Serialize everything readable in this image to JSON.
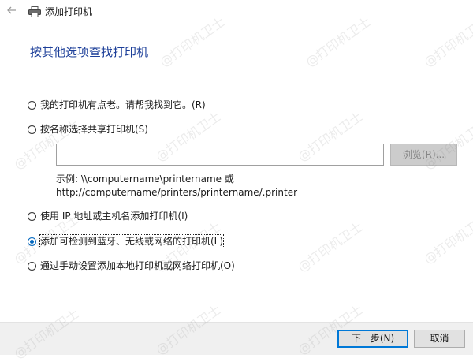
{
  "window": {
    "title": "添加打印机",
    "back_icon": "back-arrow-icon",
    "printer_icon": "printer-icon"
  },
  "heading": "按其他选项查找打印机",
  "options": [
    {
      "label": "我的打印机有点老。请帮我找到它。(R)",
      "checked": false
    },
    {
      "label": "按名称选择共享打印机(S)",
      "checked": false
    },
    {
      "label": "使用 IP 地址或主机名添加打印机(I)",
      "checked": false
    },
    {
      "label": "添加可检测到蓝牙、无线或网络的打印机(L)",
      "checked": true
    },
    {
      "label": "通过手动设置添加本地打印机或网络打印机(O)",
      "checked": false
    }
  ],
  "shared_printer": {
    "input_value": "",
    "browse_label": "浏览(R)...",
    "example_line1": "示例: \\\\computername\\printername 或",
    "example_line2": "http://computername/printers/printername/.printer"
  },
  "footer": {
    "next_label": "下一步(N)",
    "cancel_label": "取消"
  },
  "watermark_text": "@打印机卫士",
  "colors": {
    "heading": "#1d3f99",
    "accent": "#0078d7",
    "footer_bg": "#f0f0f0"
  }
}
